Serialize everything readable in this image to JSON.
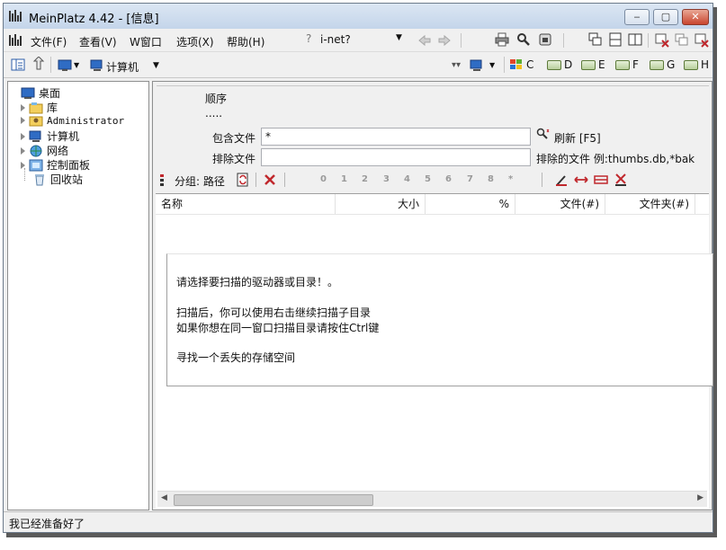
{
  "window": {
    "title": "MeinPlatz 4.42 - [信息]"
  },
  "menu": {
    "file": "文件(F)",
    "view": "查看(V)",
    "window": "W窗口",
    "options": "选项(X)",
    "help": "帮助(H)"
  },
  "quicklink": {
    "help_mark": "?",
    "label": "i-net?"
  },
  "address": {
    "label": "计算机"
  },
  "drives": [
    "C",
    "D",
    "E",
    "F",
    "G",
    "H"
  ],
  "tree": {
    "items": [
      {
        "label": "桌面",
        "icon": "desktop-icon"
      },
      {
        "label": "库",
        "icon": "library-icon"
      },
      {
        "label": "Administrator",
        "icon": "user-folder-icon"
      },
      {
        "label": "计算机",
        "icon": "computer-icon"
      },
      {
        "label": "网络",
        "icon": "network-icon"
      },
      {
        "label": "控制面板",
        "icon": "control-panel-icon"
      },
      {
        "label": "回收站",
        "icon": "recycle-bin-icon"
      }
    ]
  },
  "filters": {
    "order_label": "顺序",
    "order_value": ".....",
    "include_label": "包含文件",
    "include_value": "*",
    "refresh_label": "刷新 [F5]",
    "exclude_label": "排除文件",
    "exclude_value": "",
    "exclude_hint": "排除的文件 例:thumbs.db,*bak"
  },
  "group_toolbar": {
    "group_label": "分组: 路径",
    "levels": [
      "0",
      "1",
      "2",
      "3",
      "4",
      "5",
      "6",
      "7",
      "8",
      "*"
    ]
  },
  "columns": [
    "名称",
    "大小",
    "%",
    "文件(#)",
    "文件夹(#)"
  ],
  "info": {
    "line1": "请选择要扫描的驱动器或目录！。",
    "line2": "扫描后，你可以使用右击继续扫描子目录",
    "line3": "如果你想在同一窗口扫描目录请按住Ctrl键",
    "line4": "寻找一个丢失的存储空间"
  },
  "status": {
    "text": "我已经准备好了"
  }
}
